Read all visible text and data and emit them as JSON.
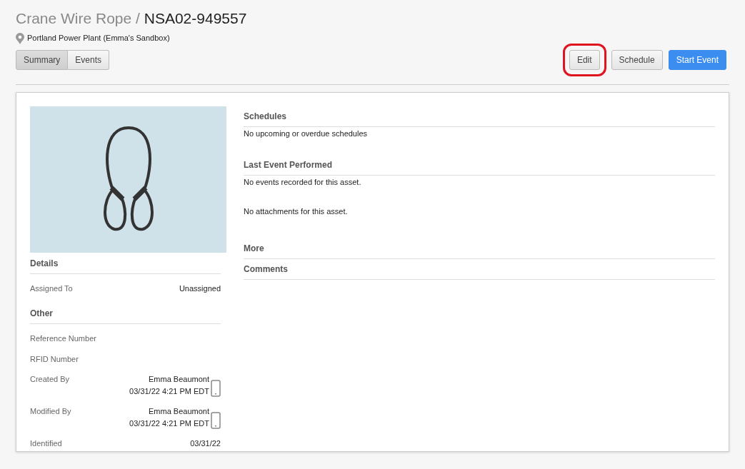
{
  "header": {
    "asset_type": "Crane Wire Rope",
    "separator": "/",
    "asset_id": "NSA02-949557",
    "location": "Portland Power Plant (Emma's Sandbox)"
  },
  "tabs": [
    {
      "label": "Summary",
      "selected": true
    },
    {
      "label": "Events",
      "selected": false
    }
  ],
  "actions": [
    {
      "label": "Edit",
      "kind": "default",
      "highlighted": true
    },
    {
      "label": "Schedule",
      "kind": "default",
      "highlighted": false
    },
    {
      "label": "Start Event",
      "kind": "primary",
      "highlighted": false
    }
  ],
  "details_sections": [
    {
      "title": "Details",
      "rows": [
        {
          "label": "Assigned To",
          "kind": "text",
          "value": "Unassigned"
        }
      ]
    },
    {
      "title": "Other",
      "rows": [
        {
          "label": "Reference Number",
          "kind": "text"
        },
        {
          "label": "RFID Number",
          "kind": "text"
        },
        {
          "label": "Created By",
          "kind": "device",
          "value": "Emma Beaumont",
          "time": "03/31/22 4:21 PM EDT"
        },
        {
          "label": "Modified By",
          "kind": "device",
          "value": "Emma Beaumont",
          "time": "03/31/22 4:21 PM EDT"
        },
        {
          "label": "Identified",
          "kind": "text",
          "value": "03/31/22"
        }
      ]
    }
  ],
  "main_sections": [
    {
      "kind": "section",
      "title": "Schedules",
      "text": "No upcoming or overdue schedules"
    },
    {
      "kind": "section",
      "title": "Last Event Performed",
      "text": "No events recorded for this asset."
    },
    {
      "kind": "note",
      "text": "No attachments for this asset."
    },
    {
      "kind": "section",
      "title": "More"
    },
    {
      "kind": "section",
      "title": "Comments"
    }
  ]
}
